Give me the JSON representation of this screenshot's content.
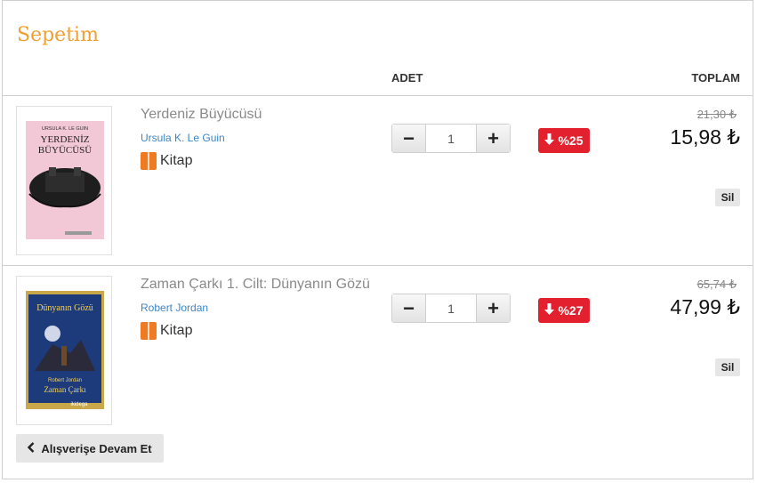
{
  "cart": {
    "title": "Sepetim",
    "columns": {
      "quantity": "ADET",
      "total": "TOPLAM"
    },
    "continue_label": "Alışverişe Devam Et",
    "accent_color": "#f0a030"
  },
  "items": [
    {
      "title": "Yerdeniz Büyücüsü",
      "author": "Ursula K. Le Guin",
      "type": "Kitap",
      "quantity": "1",
      "discount": "%25",
      "old_price": "21,30 ₺",
      "price": "15,98 ₺",
      "delete_label": "Sil",
      "cover": {
        "author": "URSULA K. LE GUIN",
        "title_line1": "YERDENİZ",
        "title_line2": "BÜYÜCÜSÜ",
        "bg": "#f2c8d6"
      }
    },
    {
      "title": "Zaman Çarkı 1. Cilt: Dünyanın Gözü",
      "author": "Robert Jordan",
      "type": "Kitap",
      "quantity": "1",
      "discount": "%27",
      "old_price": "65,74 ₺",
      "price": "47,99 ₺",
      "delete_label": "Sil",
      "cover": {
        "title_top": "Dünyanın Gözü",
        "author": "Robert Jordan",
        "series": "Zaman Çarkı",
        "publisher": "ikidega",
        "bg": "#c8a848"
      }
    }
  ],
  "icons": {
    "minus": "−",
    "plus": "+",
    "discount_arrow": "down-arrow-icon",
    "back": "chevron-left-icon",
    "book": "book-icon"
  },
  "colors": {
    "discount_bg": "#e3202d",
    "author_link": "#3d86c6",
    "book_icon": "#f07a22"
  }
}
